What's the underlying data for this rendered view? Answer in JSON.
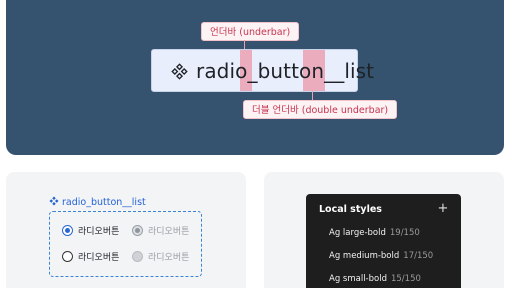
{
  "hero": {
    "component_name": "radio_button__list",
    "icon": "component-diamond-icon",
    "annotations": {
      "underbar": "언더바 (underbar)",
      "double_underbar": "더블 언더바 (double underbar)"
    },
    "colors": {
      "background": "#35536f",
      "highlight": "#ec788c",
      "annotation_text": "#c8344f"
    }
  },
  "example": {
    "title": "radio_button__list",
    "icon": "component-diamond-icon",
    "rows": [
      [
        {
          "label": "라디오버튼",
          "state": "checked"
        },
        {
          "label": "라디오버튼",
          "state": "disabled-checked"
        }
      ],
      [
        {
          "label": "라디오버튼",
          "state": "unchecked"
        },
        {
          "label": "라디오버튼",
          "state": "disabled"
        }
      ]
    ],
    "colors": {
      "accent": "#2463d6",
      "frame": "#3a84d8"
    }
  },
  "local_styles": {
    "title": "Local styles",
    "add_icon": "plus-icon",
    "add_label": "+",
    "items": [
      {
        "name": "Ag large-bold",
        "meta": "19/150"
      },
      {
        "name": "Ag medium-bold",
        "meta": "17/150"
      },
      {
        "name": "Ag small-bold",
        "meta": "15/150"
      }
    ]
  }
}
